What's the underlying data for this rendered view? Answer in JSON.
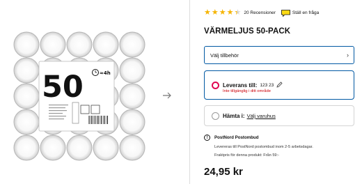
{
  "product": {
    "image_pack_count": "50",
    "image_burn_time": "≈4h"
  },
  "rating": {
    "stars": 4.4,
    "reviews_label": "20 Recensioner",
    "ask_label": "Ställ en fråga",
    "star_color": "#f5b400"
  },
  "title": "VÄRMELJUS 50-PACK",
  "accessory": {
    "label": "Välj tillbehör",
    "icon": "chevron-right-icon"
  },
  "delivery": {
    "label": "Leverans till:",
    "postcode": "123 23",
    "status": "Inte tillgänglig i ditt område",
    "status_color": "#cc0008",
    "accent_color": "#e00751"
  },
  "pickup": {
    "label": "Hämta i:",
    "store_link": "Välj varuhus"
  },
  "shipping": {
    "title": "PostNord Postombud",
    "line1": "Levereras till PostNord postombud inom 2-5 arbetsdagar.",
    "line2": "Fraktpris för denna produkt: Från 59:-"
  },
  "price": "24,95 kr",
  "colors": {
    "blue": "#0058a3"
  }
}
